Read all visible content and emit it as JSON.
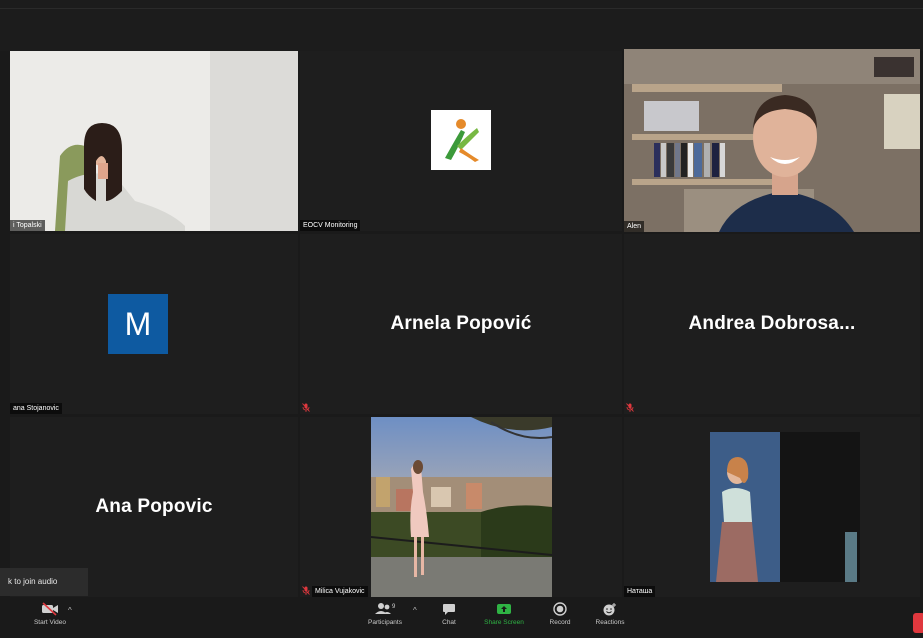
{
  "tiles": {
    "topalski": {
      "name": "i Topalski"
    },
    "eocv": {
      "name": "EOCV Monitoring"
    },
    "alen": {
      "name": "Alen"
    },
    "stojanovic": {
      "name": "ana Stojanovic",
      "avatar_letter": "M"
    },
    "arnela": {
      "big_name": "Arnela Popović"
    },
    "andrea": {
      "big_name": "Andrea  Dobrosa..."
    },
    "ana": {
      "big_name": "Ana Popovic"
    },
    "milica": {
      "name": "Milica Vujakovic"
    },
    "natasha": {
      "name": "Наташа"
    }
  },
  "audio_toast": {
    "text": "k to join audio"
  },
  "toolbar": {
    "start_video": "Start Video",
    "participants": "Participants",
    "participants_count": "9",
    "chat": "Chat",
    "share_screen": "Share Screen",
    "record": "Record",
    "reactions": "Reactions"
  },
  "colors": {
    "active_speaker": "#d6e06a",
    "share_green": "#2fb344",
    "avatar_blue": "#0e5aa1",
    "mute_red": "#e0383e"
  }
}
